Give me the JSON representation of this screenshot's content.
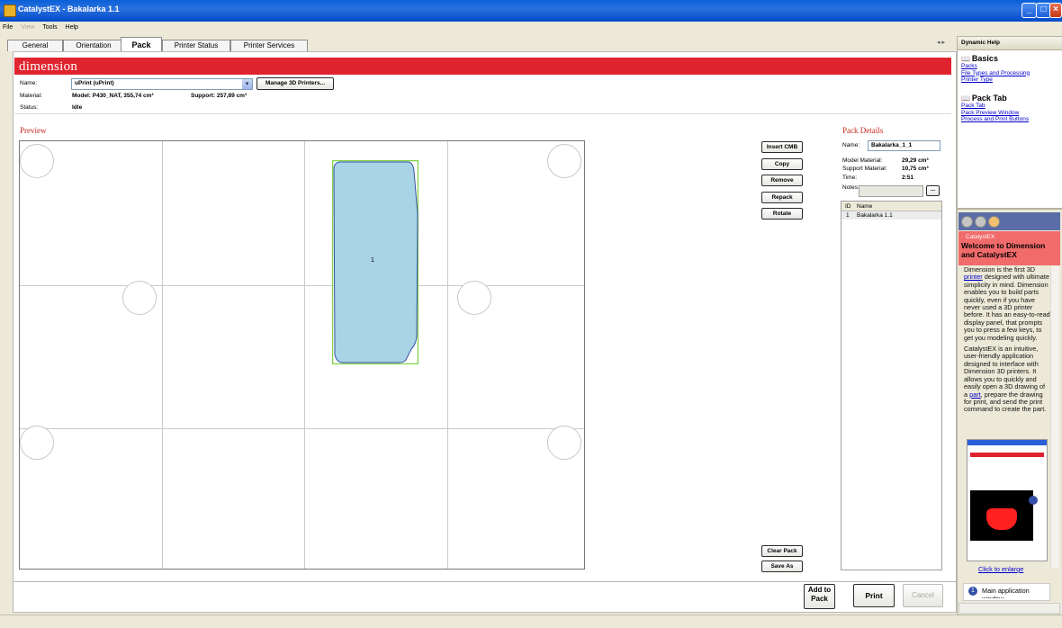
{
  "window": {
    "title": "CatalystEX - Bakalarka 1.1"
  },
  "menu": [
    "File",
    "View",
    "Tools",
    "Help"
  ],
  "tabs": [
    "General",
    "Orientation",
    "Pack",
    "Printer Status",
    "Printer Services"
  ],
  "active_tab": "Pack",
  "tab_arrows": "◂ ▸",
  "header": {
    "logo": "dimension",
    "name_label": "Name:",
    "name_value": "uPrint (uPrint)",
    "manage_button": "Manage 3D Printers...",
    "material_label": "Material:",
    "material_value": "Model: P430_NAT, 355,74 cm³",
    "support_value": "Support: 257,89 cm³",
    "status_label": "Status:",
    "status_value": "Idle"
  },
  "preview": {
    "label": "Preview",
    "part_number": "1"
  },
  "side_buttons": [
    "Insert CMB",
    "Copy",
    "Remove",
    "Repack",
    "Rotate"
  ],
  "bottom_side_buttons": [
    "Clear Pack",
    "Save As"
  ],
  "pack_details": {
    "label": "Pack Details",
    "name_label": "Name:",
    "name_value": "Bakalarka_1_1",
    "model_material_label": "Model Material:",
    "model_material_value": "29,29 cm³",
    "support_material_label": "Support Material:",
    "support_material_value": "10,75 cm³",
    "time_label": "Time:",
    "time_value": "2:51",
    "notes_label": "Notes:",
    "notes_button": "...",
    "list_headers": [
      "ID",
      "Name"
    ],
    "list_rows": [
      {
        "id": "1",
        "name": "Bakalarka 1.1"
      }
    ]
  },
  "bottom_buttons": {
    "add_to_pack_1": "Add to",
    "add_to_pack_2": "Pack",
    "print": "Print",
    "cancel": "Cancel"
  },
  "help": {
    "header": "Dynamic Help",
    "sections": [
      {
        "title": "Basics",
        "links": [
          "Packs",
          "File Types and Processing",
          "Printer Type"
        ]
      },
      {
        "title": "Pack Tab",
        "links": [
          "Pack Tab",
          "Pack Preview Window",
          "Process and Print Buttons"
        ]
      }
    ],
    "welcome_small": "CatalystEX",
    "welcome_title": "Welcome to Dimension and CatalystEX",
    "para1_a": "Dimension is the first 3D ",
    "para1_link": "printer",
    "para1_b": " designed with ultimate simplicity in mind. Dimension enables you to build parts quickly, even if you have never used a 3D printer before. It has an easy-to-read display panel, that prompts you to press a few keys, to get you modeling quickly.",
    "para2_a": "CatalystEX is an intuitive, user-friendly application designed to interface with Dimension 3D printers. It allows you to quickly and easily open a 3D drawing of a ",
    "para2_link": "part",
    "para2_b": ", prepare the drawing for print, and send the print command to create the part.",
    "enlarge_link": "Click to enlarge",
    "step_number": "1",
    "step_text": "Main application window"
  }
}
